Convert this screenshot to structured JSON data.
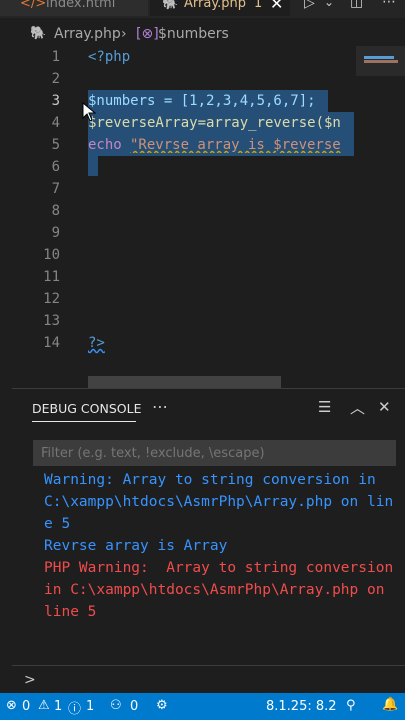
{
  "tabs": [
    {
      "label": "index.html"
    },
    {
      "label": "Array.php",
      "dirty": "1"
    }
  ],
  "breadcrumb": {
    "file": "Array.php",
    "symbol": "$numbers"
  },
  "editor": {
    "line_numbers": [
      "1",
      "2",
      "3",
      "4",
      "5",
      "6",
      "7",
      "8",
      "9",
      "10",
      "11",
      "12",
      "13",
      "14"
    ],
    "lines": {
      "l1": "<?php",
      "l3": "$numbers = [1,2,3,4,5,6,7];",
      "l4": "$reverseArray=array_reverse($n",
      "l5a": "echo ",
      "l5b": "\"Revrse array is $reverse",
      "l14": "?>"
    }
  },
  "panel": {
    "title": "DEBUG CONSOLE",
    "filter_placeholder": "Filter (e.g. text, !exclude, \\escape)",
    "output": [
      "Warning: Array to string conversion in",
      "C:\\xampp\\htdocs\\AsmrPhp\\Array.php on lin",
      "e 5",
      "Revrse array is Array",
      "PHP Warning:  Array to string conversion",
      "in C:\\xampp\\htdocs\\AsmrPhp\\Array.php on",
      "line 5"
    ],
    "prompt": ">"
  },
  "status": {
    "errors": "0",
    "warnings": "1",
    "info": "1",
    "ports": "0",
    "php_version": "8.1.25: 8.2"
  },
  "colors": {
    "selection": "#264f78",
    "warning_text": "#3794ff",
    "error_text": "#f14c4c",
    "statusbar": "#007acc"
  }
}
